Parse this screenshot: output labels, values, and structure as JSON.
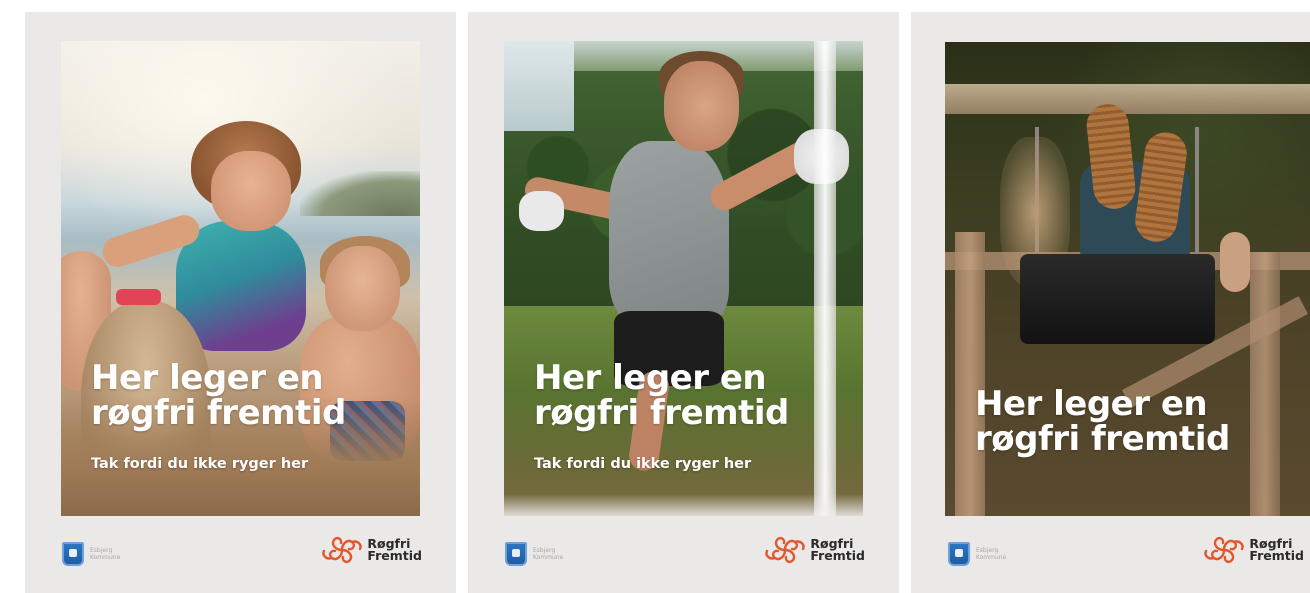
{
  "posters": [
    {
      "headline_line1": "Her leger en",
      "headline_line2": "røgfri fremtid",
      "tagline": "Tak fordi du ikke ryger her",
      "kommune_line1": "Esbjerg",
      "kommune_line2": "Kommune",
      "brand_line1": "Røgfri",
      "brand_line2": "Fremtid"
    },
    {
      "headline_line1": "Her leger en",
      "headline_line2": "røgfri fremtid",
      "tagline": "Tak fordi du ikke ryger her",
      "kommune_line1": "Esbjerg",
      "kommune_line2": "Kommune",
      "brand_line1": "Røgfri",
      "brand_line2": "Fremtid"
    },
    {
      "headline_line1": "Her leger en",
      "headline_line2": "røgfri fremtid",
      "kommune_line1": "Esbjerg",
      "kommune_line2": "Kommune",
      "brand_line1": "Røgfri",
      "brand_line2": "Fremtid"
    }
  ],
  "colors": {
    "poster_background": "#ebe9e7",
    "brand_orange": "#e4572e",
    "crest_blue": "#2d75c2",
    "text_white": "#ffffff"
  },
  "icons": {
    "brand_logo": "rogfri-fremtid-swirl-logo",
    "kommune_logo": "esbjerg-kommune-crest"
  }
}
